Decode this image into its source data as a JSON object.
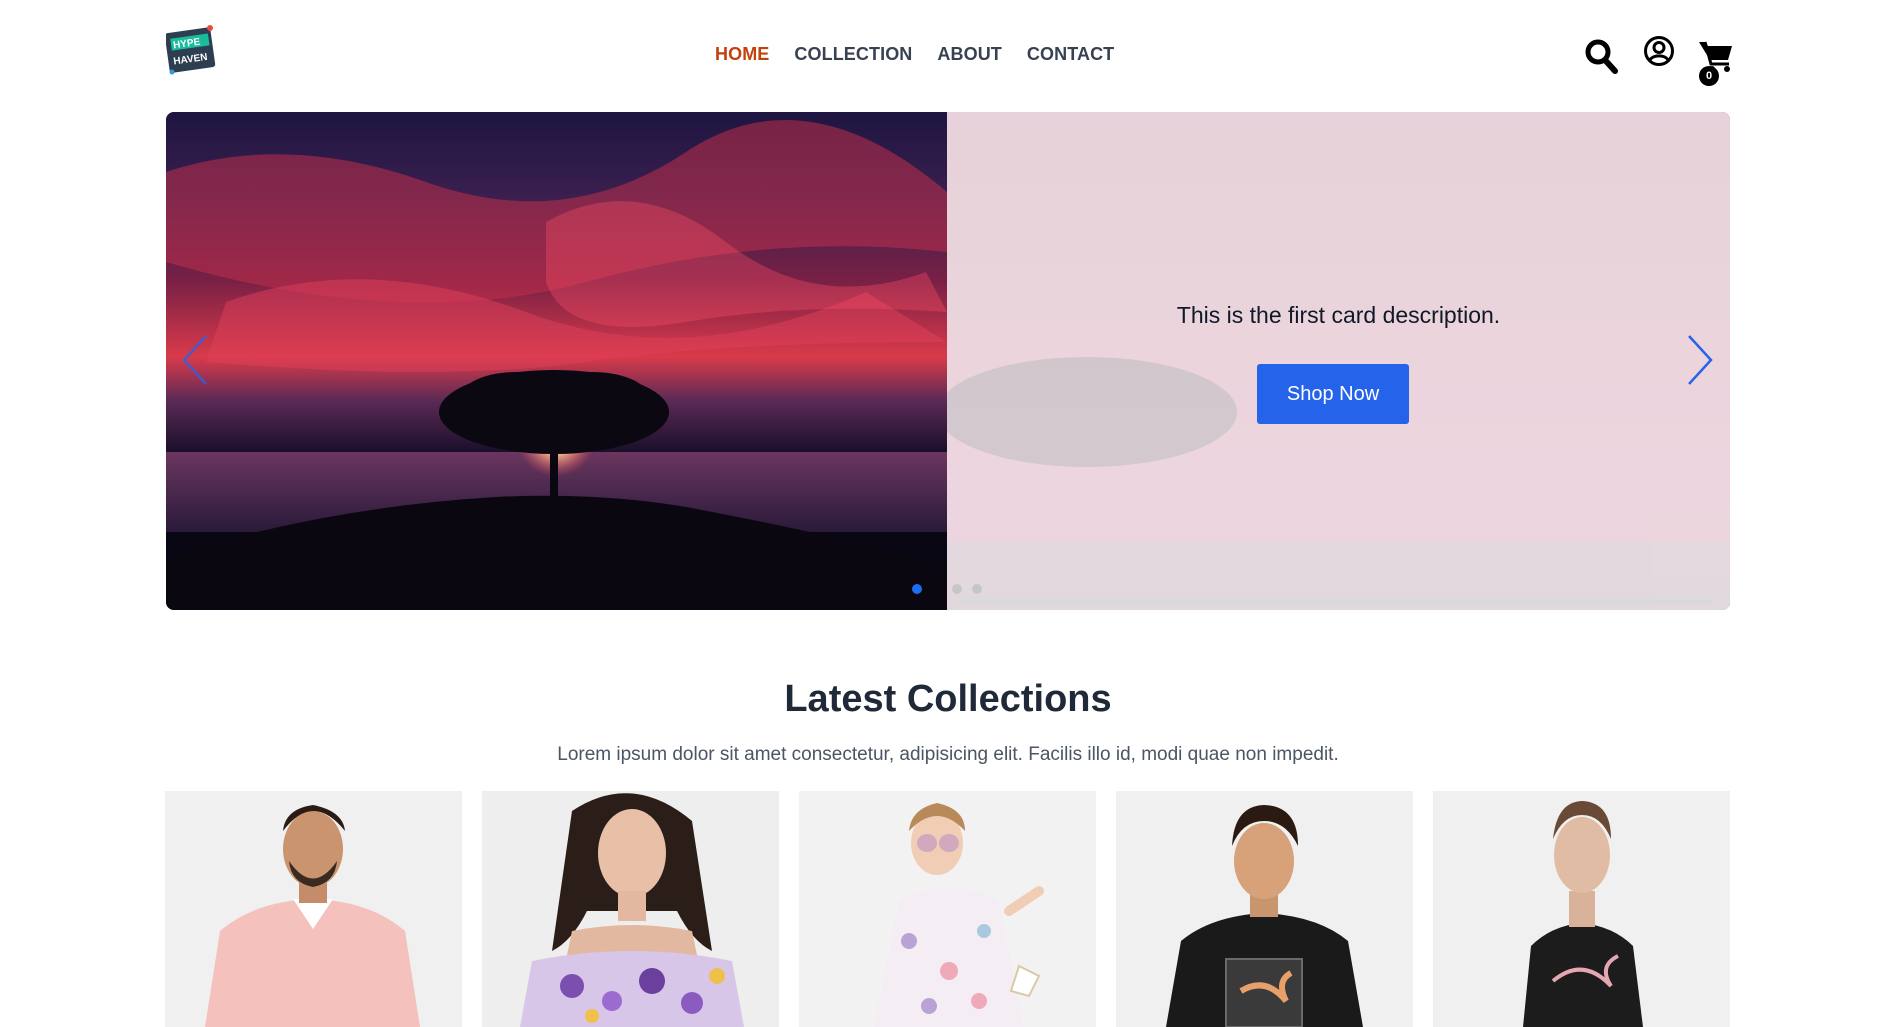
{
  "header": {
    "logo_text": "HYPE HAVEN",
    "nav": [
      {
        "label": "HOME",
        "active": true
      },
      {
        "label": "COLLECTION",
        "active": false
      },
      {
        "label": "ABOUT",
        "active": false
      },
      {
        "label": "CONTACT",
        "active": false
      }
    ],
    "icons": [
      "search-icon",
      "account-icon",
      "cart-icon"
    ],
    "cart_count": "0"
  },
  "hero": {
    "description": "This is the first card description.",
    "cta_label": "Shop Now",
    "slide_count": 3,
    "active_slide": 0,
    "colors": {
      "accent": "#2563eb",
      "active_dot": "#1d6ff2"
    }
  },
  "collections": {
    "title": "Latest Collections",
    "subtitle": "Lorem ipsum dolor sit amet consectetur, adipisicing elit. Facilis illo id, modi quae non impedit.",
    "products": [
      {
        "image": "man-pink-polo"
      },
      {
        "image": "woman-floral-off-shoulder-top"
      },
      {
        "image": "girl-floral-dress"
      },
      {
        "image": "man-black-puma-tshirt"
      },
      {
        "image": "woman-black-puma-tshirt"
      }
    ]
  }
}
